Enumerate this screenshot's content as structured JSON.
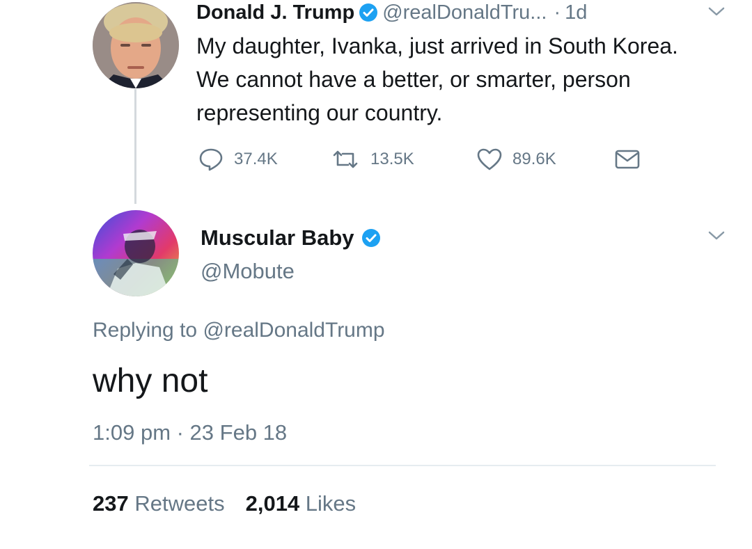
{
  "original_tweet": {
    "author_name": "Donald J. Trump",
    "handle": "@realDonaldTru...",
    "separator": "·",
    "age": "1d",
    "text": "My daughter, Ivanka, just arrived in South Korea. We cannot have a better, or smarter, person representing our country.",
    "reply_count": "37.4K",
    "retweet_count": "13.5K",
    "like_count": "89.6K"
  },
  "reply_tweet": {
    "author_name": "Muscular Baby",
    "handle": "@Mobute",
    "replying_prefix": "Replying to",
    "replying_handle": "@realDonaldTrump",
    "text": "why not",
    "timestamp": "1:09 pm · 23 Feb 18",
    "retweets_value": "237",
    "retweets_label": "Retweets",
    "likes_value": "2,014",
    "likes_label": "Likes"
  },
  "icons": {
    "verified": "verified-badge-icon",
    "reply": "reply-bubble-icon",
    "retweet": "retweet-icon",
    "like": "heart-icon",
    "dm": "envelope-icon",
    "more": "chevron-down-icon"
  },
  "colors": {
    "verified_blue": "#1da1f2",
    "secondary_text": "#657786",
    "primary_text": "#14171a",
    "thread_line": "#d4d9dd"
  }
}
